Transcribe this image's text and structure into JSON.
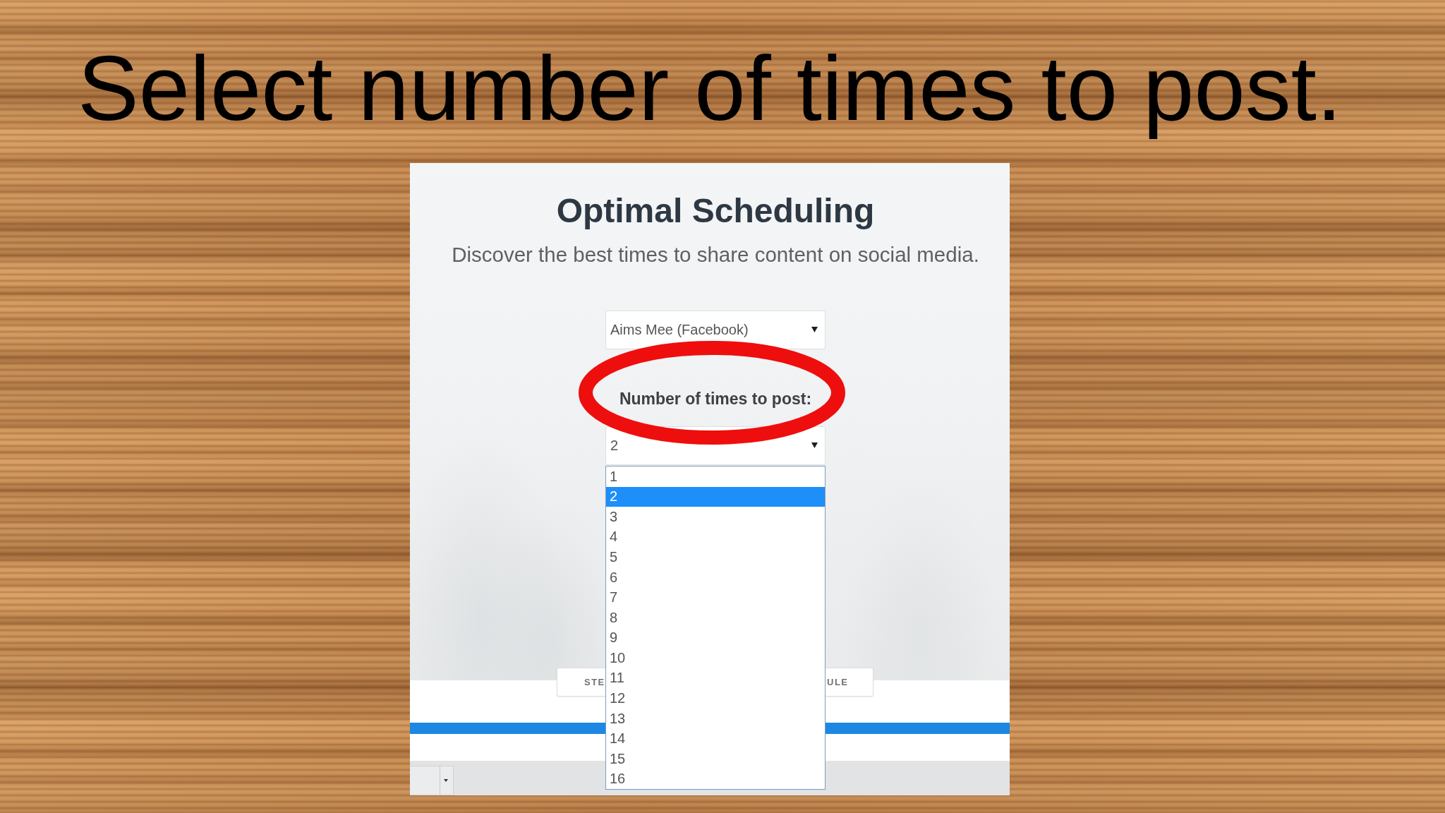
{
  "slide_title": "Select number of times to post.",
  "app": {
    "heading": "Optimal Scheduling",
    "subtitle": "Discover the best times to share content on social media.",
    "account_select": {
      "value": "Aims Mee (Facebook)"
    },
    "post_count": {
      "label": "Number of times to post:",
      "highlighted": true,
      "value": "2",
      "expanded": true,
      "options": [
        {
          "label": "1",
          "selected": false
        },
        {
          "label": "2",
          "selected": true
        },
        {
          "label": "3",
          "selected": false
        },
        {
          "label": "4",
          "selected": false
        },
        {
          "label": "5",
          "selected": false
        },
        {
          "label": "6",
          "selected": false
        },
        {
          "label": "7",
          "selected": false
        },
        {
          "label": "8",
          "selected": false
        },
        {
          "label": "9",
          "selected": false
        },
        {
          "label": "10",
          "selected": false
        },
        {
          "label": "11",
          "selected": false
        },
        {
          "label": "12",
          "selected": false
        },
        {
          "label": "13",
          "selected": false
        },
        {
          "label": "14",
          "selected": false
        },
        {
          "label": "15",
          "selected": false
        },
        {
          "label": "16",
          "selected": false
        }
      ]
    },
    "button_behind_list": {
      "visible_start": "STE",
      "visible_end": "ULE"
    }
  }
}
